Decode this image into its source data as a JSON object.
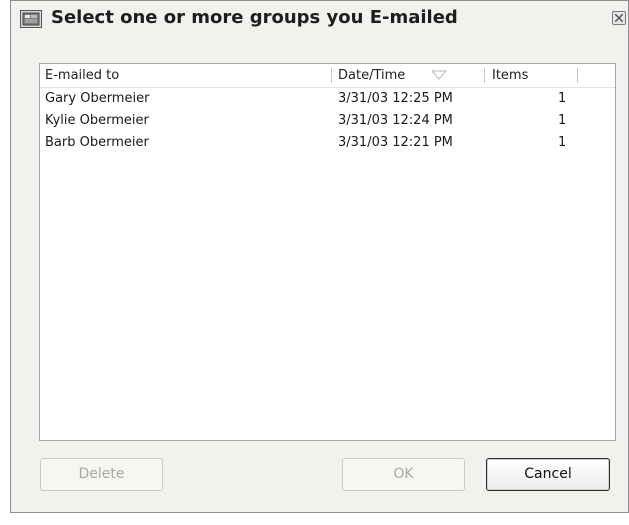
{
  "dialog": {
    "title": "Select one or more groups you E-mailed",
    "icon": "dialog-app-icon"
  },
  "list": {
    "columns": [
      {
        "label": "E-mailed to"
      },
      {
        "label": "Date/Time",
        "sorted": true
      },
      {
        "label": "Items"
      }
    ],
    "rows": [
      {
        "name": "Gary Obermeier",
        "datetime": "3/31/03 12:25 PM",
        "items": "1"
      },
      {
        "name": "Kylie Obermeier",
        "datetime": "3/31/03 12:24 PM",
        "items": "1"
      },
      {
        "name": "Barb Obermeier",
        "datetime": "3/31/03 12:21 PM",
        "items": "1"
      }
    ]
  },
  "buttons": {
    "delete": {
      "label": "Delete",
      "enabled": false
    },
    "ok": {
      "label": "OK",
      "enabled": false
    },
    "cancel": {
      "label": "Cancel",
      "enabled": true
    }
  }
}
